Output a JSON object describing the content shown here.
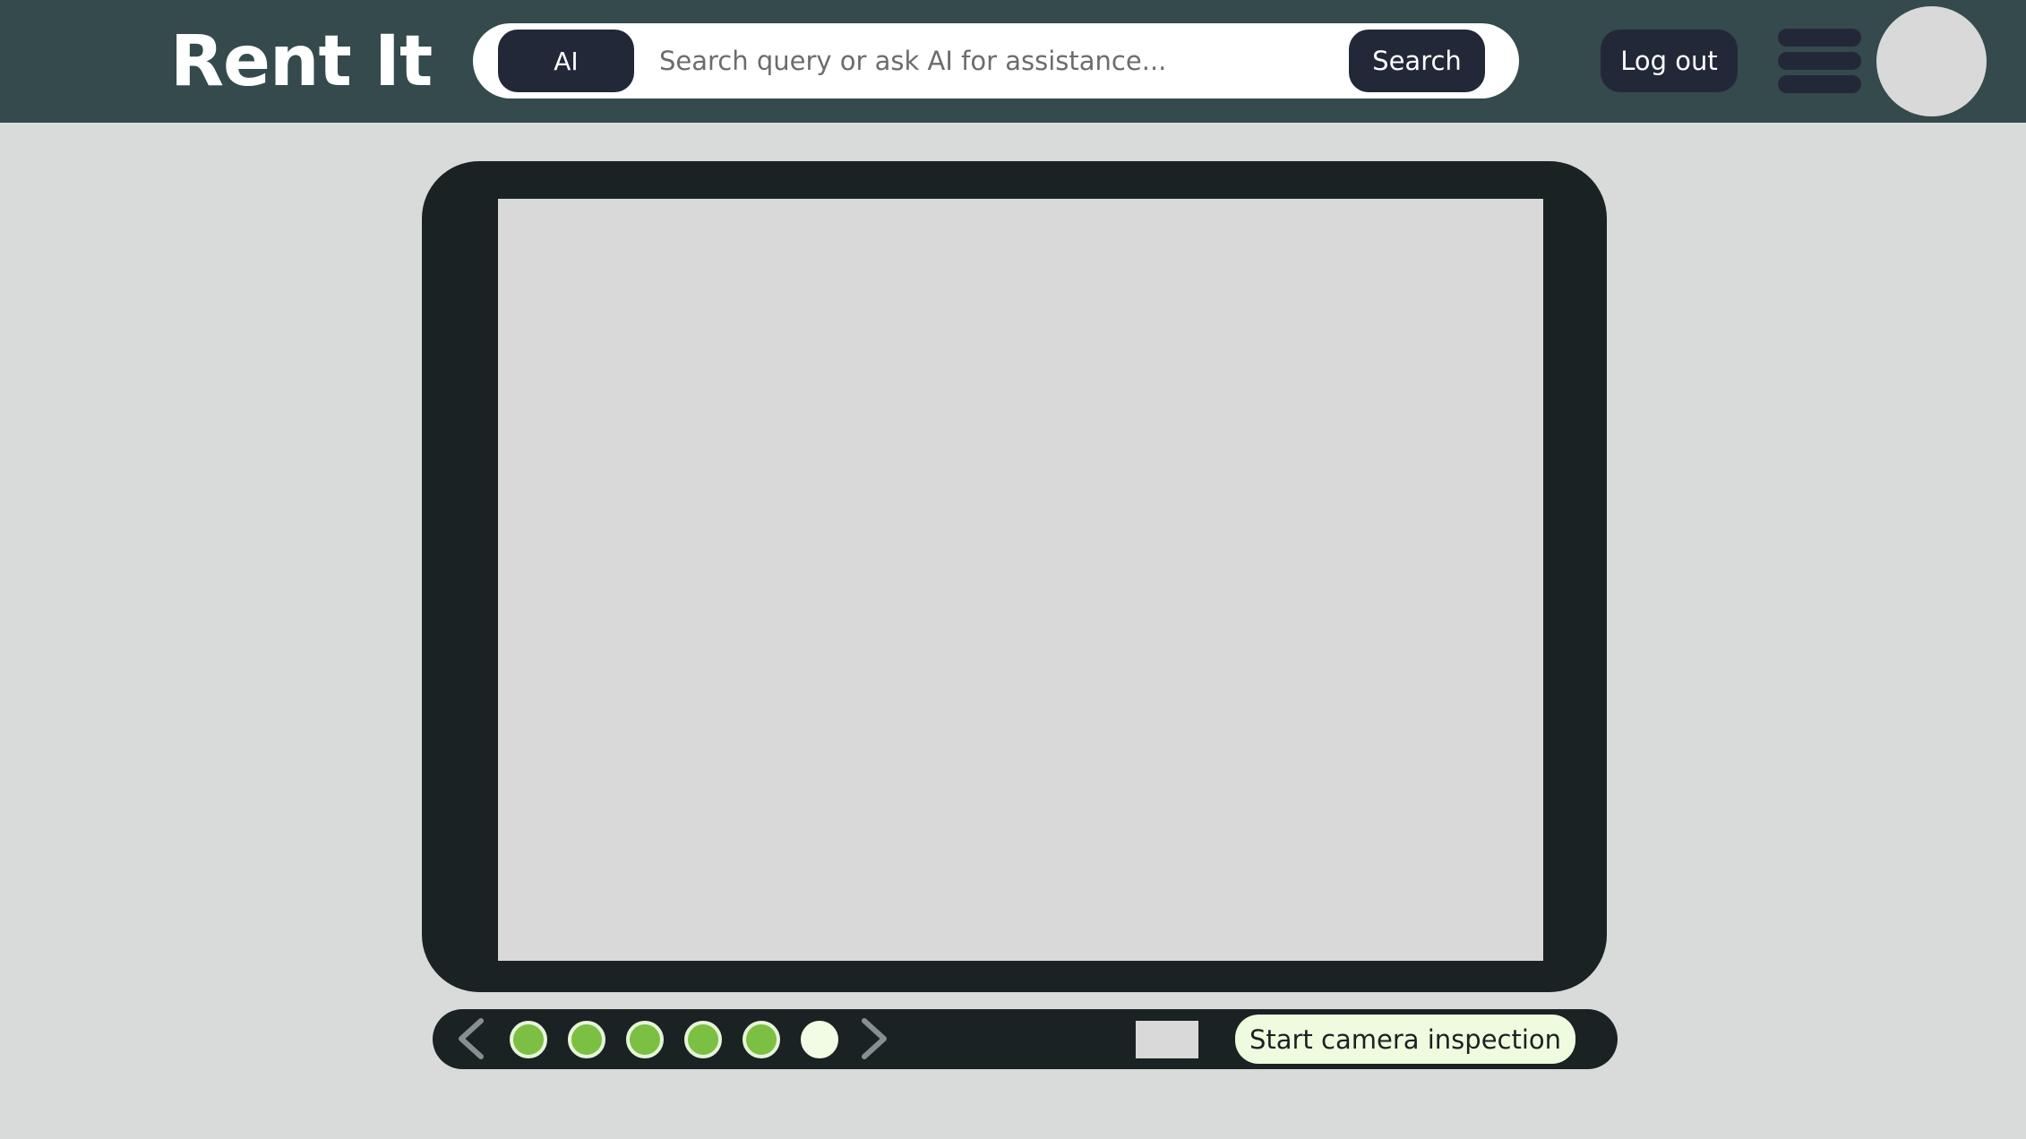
{
  "header": {
    "brand": "Rent It",
    "ai_label": "AI",
    "search_placeholder": "Search query or ask AI for assistance...",
    "search_label": "Search",
    "logout_label": "Log out",
    "menu_icon": "hamburger-menu-icon",
    "avatar": "user-avatar"
  },
  "camera": {
    "viewport": "camera-preview",
    "progress": {
      "completed_steps": 5,
      "total_steps": 6,
      "current_step": 6
    },
    "prev_icon": "chevron-left-icon",
    "next_icon": "chevron-right-icon",
    "start_label": "Start camera inspection"
  },
  "colors": {
    "header_bg": "#344a4c",
    "page_bg": "#d9dbda",
    "dark_button": "#232838",
    "frame": "#1b2223",
    "dot_complete": "#7bc043",
    "dot_pending": "#f2fbe4",
    "start_button_bg": "#effbdf"
  }
}
